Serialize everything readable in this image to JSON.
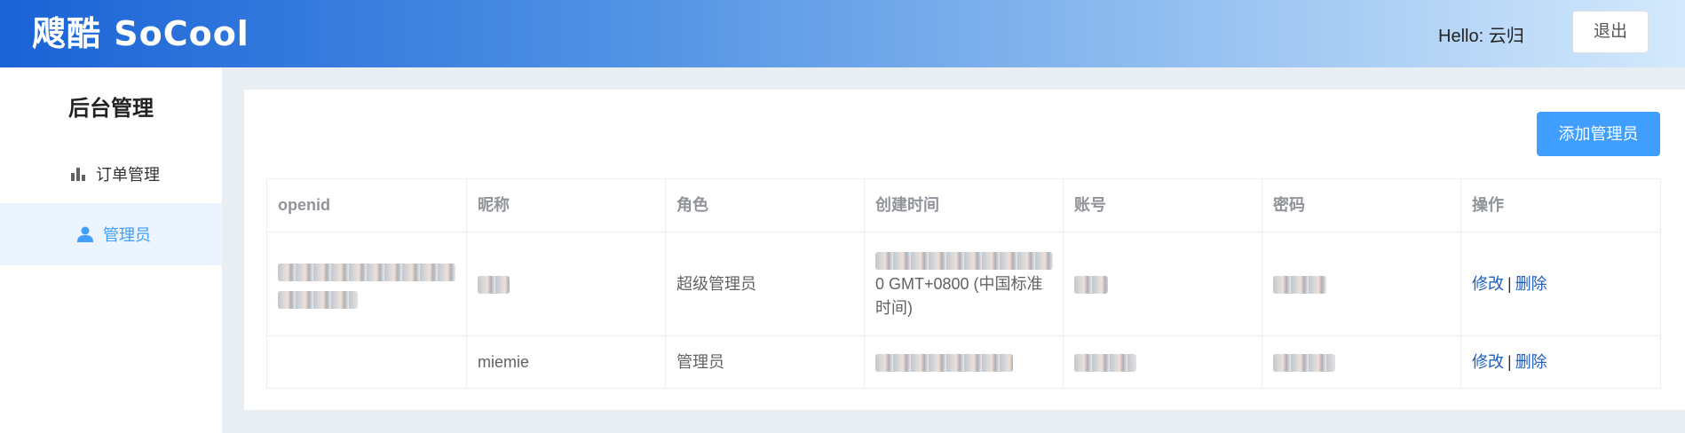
{
  "header": {
    "brand": "飕酷  SoCool",
    "greeting": "Hello: 云归",
    "logout_label": "退出"
  },
  "sidebar": {
    "title": "后台管理",
    "items": [
      {
        "label": "订单管理",
        "icon": "bar-chart-icon"
      },
      {
        "label": "管理员",
        "icon": "user-icon",
        "active": true
      }
    ]
  },
  "main": {
    "add_button_label": "添加管理员",
    "table": {
      "headers": [
        "openid",
        "昵称",
        "角色",
        "创建时间",
        "账号",
        "密码",
        "操作"
      ],
      "rows": [
        {
          "nickname": "",
          "role": "超级管理员",
          "created_visible": "0 GMT+0800 (中国标准时间)",
          "edit_label": "修改",
          "delete_label": "删除"
        },
        {
          "nickname": "miemie",
          "role": "管理员",
          "edit_label": "修改",
          "delete_label": "删除"
        }
      ]
    }
  },
  "colors": {
    "primary": "#409eff",
    "active_bg": "#ecf5ff",
    "header_start": "#1a63d6"
  }
}
